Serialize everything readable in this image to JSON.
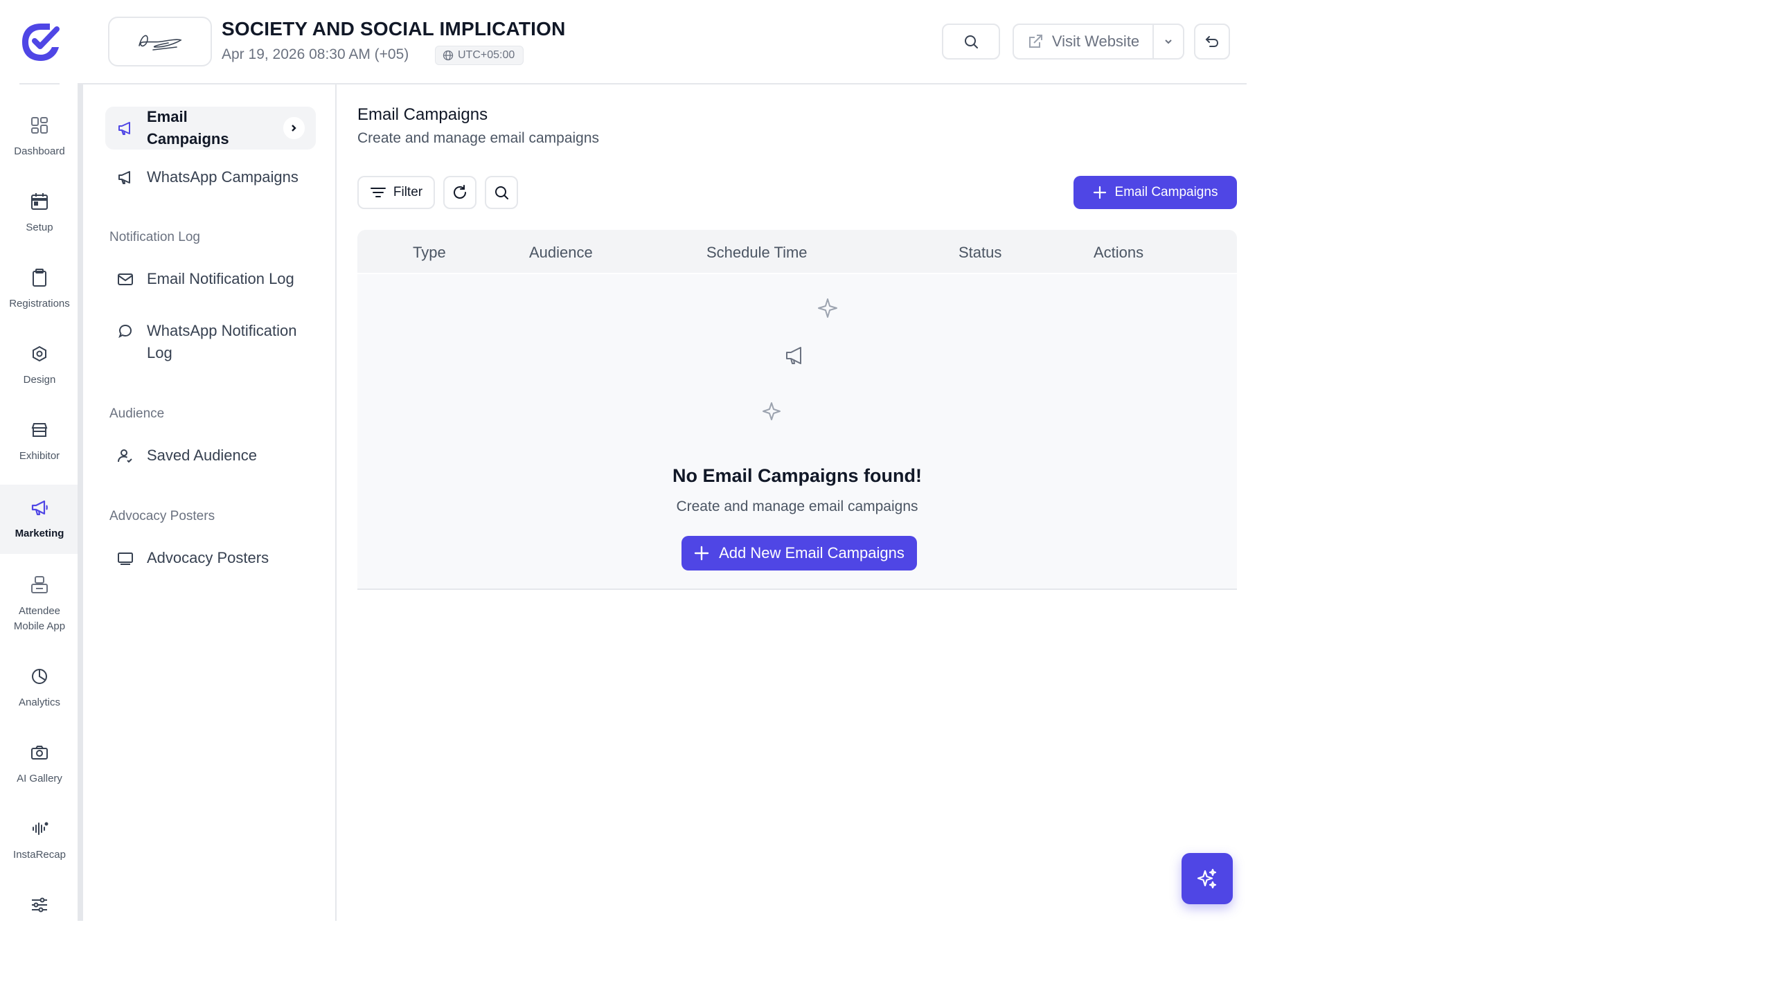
{
  "colors": {
    "accent": "#4f46e5",
    "border": "#e5e7eb",
    "muted_text": "#6b7280"
  },
  "rail": {
    "items": [
      {
        "label": "Dashboard",
        "icon": "grid-icon"
      },
      {
        "label": "Setup",
        "icon": "calendar-icon"
      },
      {
        "label": "Registrations",
        "icon": "clipboard-icon"
      },
      {
        "label": "Design",
        "icon": "settings-hex-icon"
      },
      {
        "label": "Exhibitor",
        "icon": "store-icon"
      },
      {
        "label": "Marketing",
        "icon": "megaphone-icon",
        "active": true
      },
      {
        "label": "Attendee Mobile App",
        "icon": "mobile-app-icon"
      },
      {
        "label": "Analytics",
        "icon": "pie-chart-icon"
      },
      {
        "label": "AI Gallery",
        "icon": "camera-icon"
      },
      {
        "label": "InstaRecap",
        "icon": "waveform-icon"
      },
      {
        "label": "",
        "icon": "sliders-icon"
      }
    ]
  },
  "header": {
    "title": "SOCIETY AND SOCIAL IMPLICATION",
    "date": "Apr 19, 2026 08:30 AM (+05)",
    "timezone": "UTC+05:00",
    "visit_website": "Visit Website"
  },
  "subnav": {
    "email_campaigns": "Email Campaigns",
    "whatsapp_campaigns": "WhatsApp Campaigns",
    "notification_log_section": "Notification Log",
    "email_notification_log": "Email Notification Log",
    "whatsapp_notification_log": "WhatsApp Notification Log",
    "audience_section": "Audience",
    "saved_audience": "Saved Audience",
    "advocacy_section": "Advocacy Posters",
    "advocacy_posters": "Advocacy Posters"
  },
  "main": {
    "title": "Email Campaigns",
    "subtitle": "Create and manage email campaigns",
    "filter_label": "Filter",
    "add_button": "Email Campaigns",
    "table_headers": [
      "Type",
      "Audience",
      "Schedule Time",
      "Status",
      "Actions"
    ],
    "empty_title": "No Email Campaigns found!",
    "empty_subtitle": "Create and manage email campaigns",
    "empty_button": "Add New Email Campaigns"
  }
}
